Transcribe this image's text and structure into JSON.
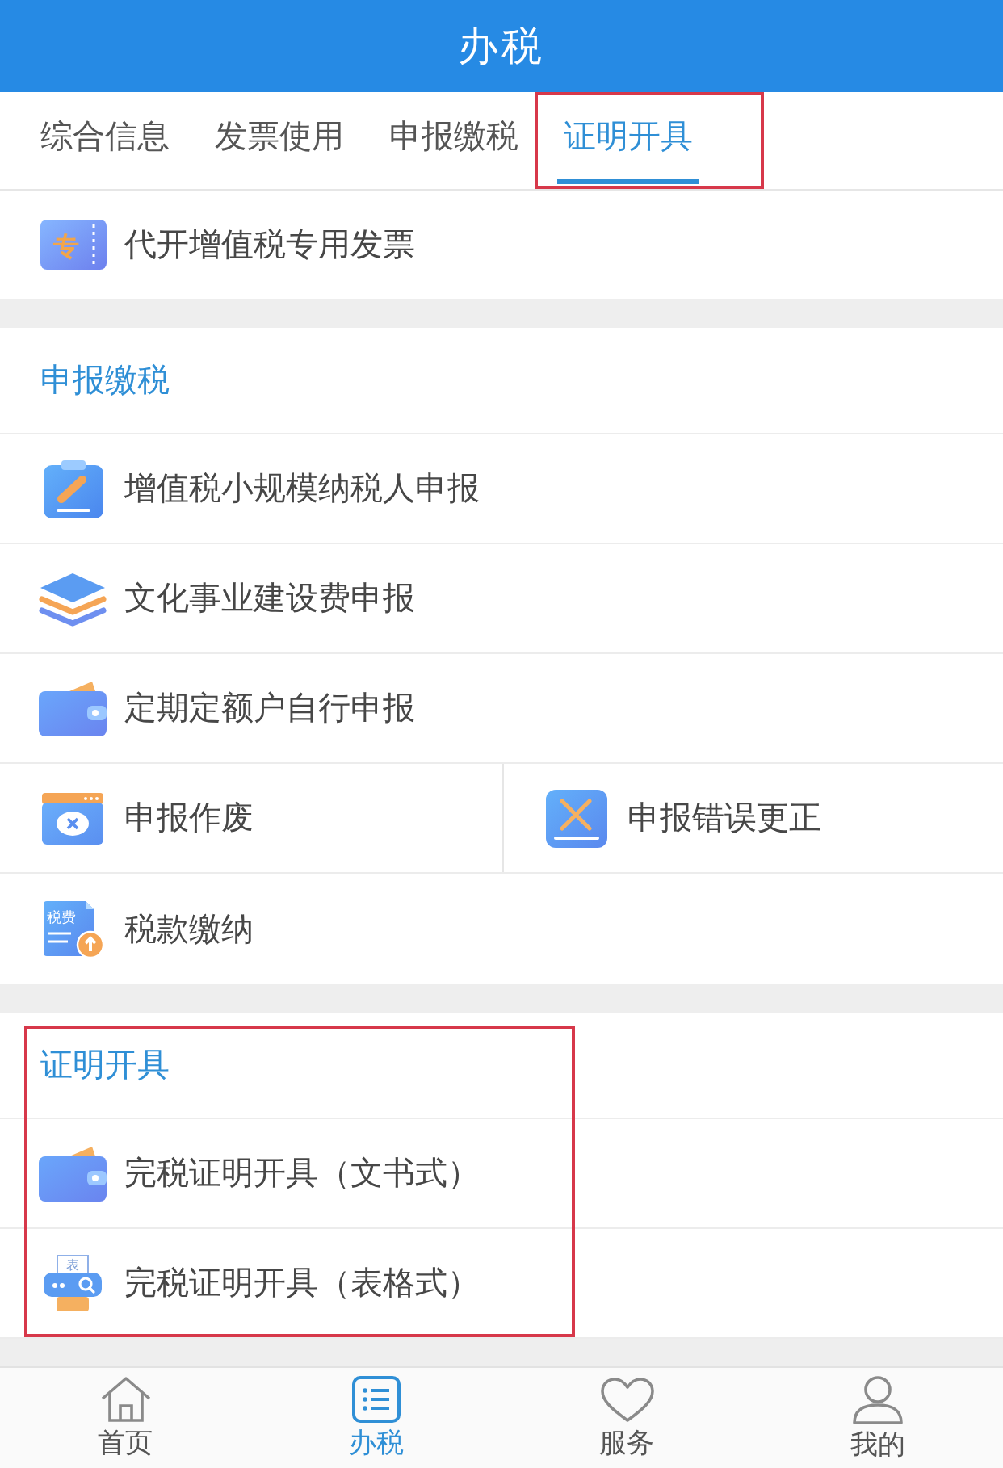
{
  "header": {
    "title": "办税"
  },
  "tabs": [
    {
      "label": "综合信息",
      "selected": false,
      "highlighted": false
    },
    {
      "label": "发票使用",
      "selected": false,
      "highlighted": false
    },
    {
      "label": "申报缴税",
      "selected": false,
      "highlighted": false
    },
    {
      "label": "证明开具",
      "selected": true,
      "highlighted": true
    }
  ],
  "sections": [
    {
      "highlighted": false,
      "rows": [
        [
          {
            "label": "代开增值税专用发票",
            "icon_text": "专"
          }
        ]
      ]
    },
    {
      "title": "申报缴税",
      "highlighted": false,
      "rows": [
        [
          {
            "label": "增值税小规模纳税人申报"
          }
        ],
        [
          {
            "label": "文化事业建设费申报"
          }
        ],
        [
          {
            "label": "定期定额户自行申报"
          }
        ],
        [
          {
            "label": "申报作废"
          },
          {
            "label": "申报错误更正"
          }
        ],
        [
          {
            "label": "税款缴纳",
            "icon_text": "税费"
          }
        ]
      ]
    },
    {
      "title": "证明开具",
      "highlighted": true,
      "rows": [
        [
          {
            "label": "完税证明开具（文书式）"
          }
        ],
        [
          {
            "label": "完税证明开具（表格式）",
            "icon_text": "表"
          }
        ]
      ]
    }
  ],
  "nav": [
    {
      "label": "首页",
      "selected": false
    },
    {
      "label": "办税",
      "selected": true
    },
    {
      "label": "服务",
      "selected": false
    },
    {
      "label": "我的",
      "selected": false
    }
  ]
}
